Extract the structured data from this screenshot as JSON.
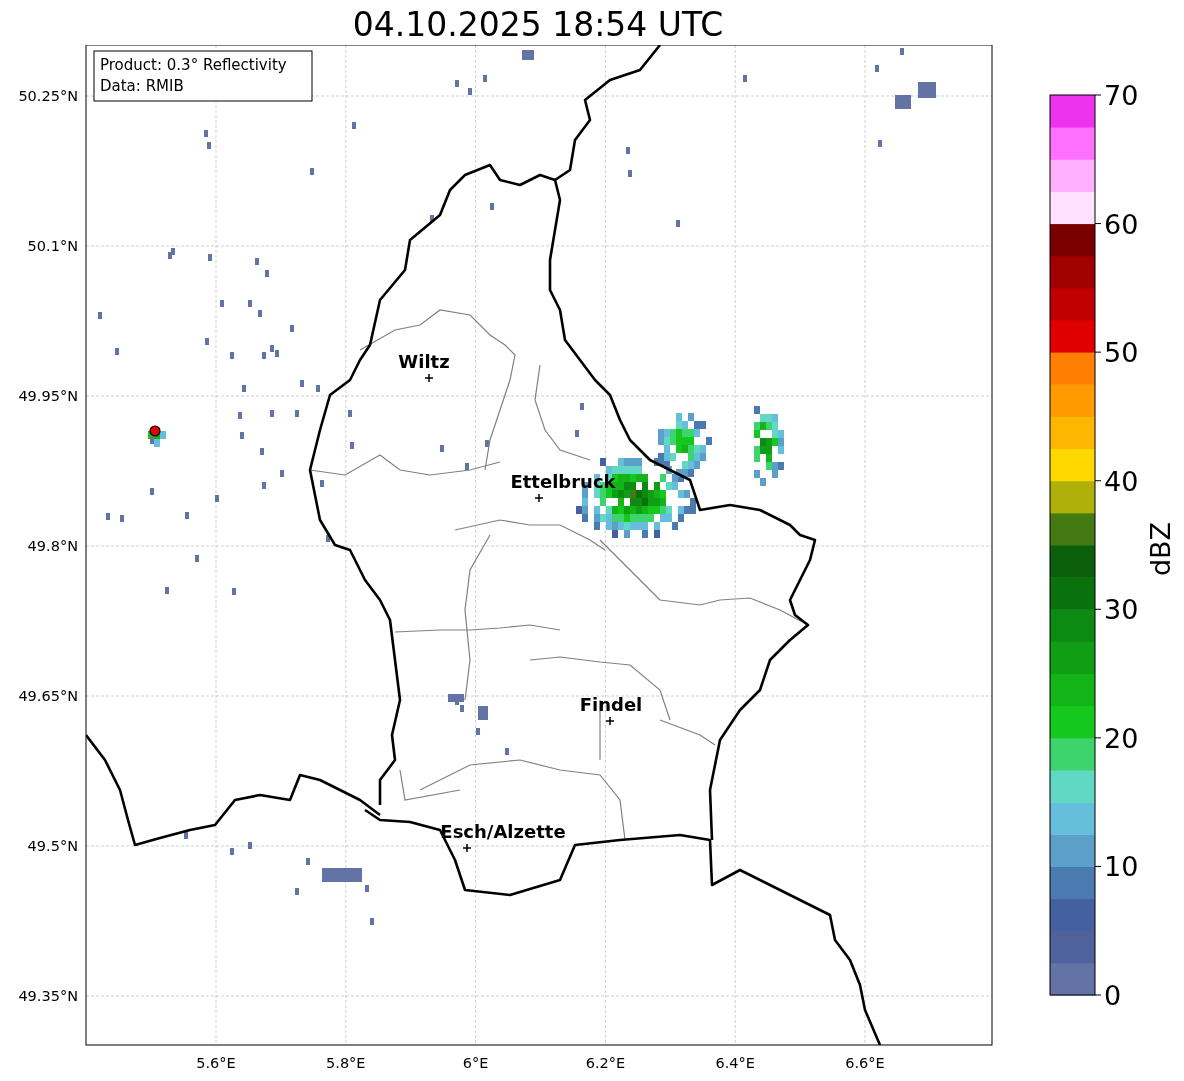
{
  "title": "04.10.2025 18:54 UTC",
  "info_box": {
    "lines": [
      "Product: 0.3° Reflectivity",
      "Data: RMIB"
    ]
  },
  "map": {
    "y_ticks": [
      "50.25°N",
      "50.1°N",
      "49.95°N",
      "49.8°N",
      "49.65°N",
      "49.5°N",
      "49.35°N"
    ],
    "x_ticks": [
      "5.6°E",
      "5.8°E",
      "6°E",
      "6.2°E",
      "6.4°E",
      "6.6°E"
    ],
    "cities": [
      {
        "name": "Wiltz"
      },
      {
        "name": "Ettelbruck"
      },
      {
        "name": "Findel"
      },
      {
        "name": "Esch/Alzette"
      }
    ]
  },
  "colorbar": {
    "label": "dBZ",
    "ticks": [
      "70",
      "60",
      "50",
      "40",
      "30",
      "20",
      "10",
      "0"
    ],
    "bins": [
      {
        "color": "#6373a6"
      },
      {
        "color": "#4f629c"
      },
      {
        "color": "#4560a0"
      },
      {
        "color": "#4a7ab0"
      },
      {
        "color": "#5aa0c8"
      },
      {
        "color": "#65bfdc"
      },
      {
        "color": "#60d8c4"
      },
      {
        "color": "#3dd46e"
      },
      {
        "color": "#14c81c"
      },
      {
        "color": "#12b418"
      },
      {
        "color": "#109e15"
      },
      {
        "color": "#0c8a12"
      },
      {
        "color": "#0a720d"
      },
      {
        "color": "#0b5e0b"
      },
      {
        "color": "#457a12"
      },
      {
        "color": "#b0b00a"
      },
      {
        "color": "#ffd800"
      },
      {
        "color": "#ffb600"
      },
      {
        "color": "#ff9a00"
      },
      {
        "color": "#ff7f00"
      },
      {
        "color": "#e00000"
      },
      {
        "color": "#c00000"
      },
      {
        "color": "#a00000"
      },
      {
        "color": "#7a0000"
      },
      {
        "color": "#ffe0ff"
      },
      {
        "color": "#ffb0ff"
      },
      {
        "color": "#ff70ff"
      },
      {
        "color": "#ee33ee"
      }
    ]
  }
}
